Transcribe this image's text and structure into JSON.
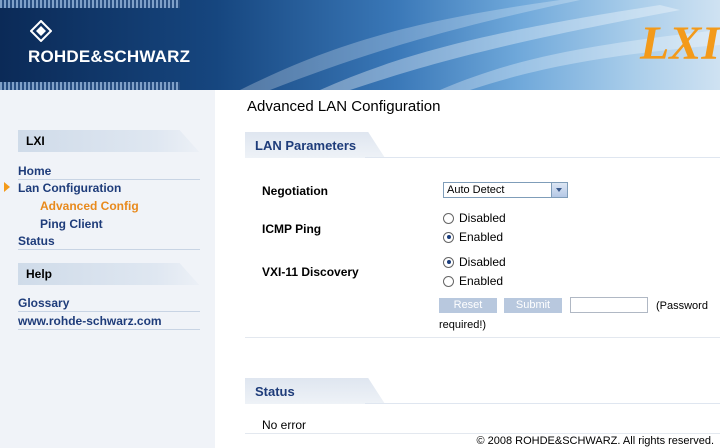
{
  "banner": {
    "brand": "ROHDE&SCHWARZ",
    "lxi_mark": "LXI"
  },
  "sidebar": {
    "sections": [
      {
        "title": "LXI"
      },
      {
        "title": "Help"
      }
    ],
    "lxi_items": [
      {
        "label": "Home"
      },
      {
        "label": "Lan Configuration"
      },
      {
        "label": "Advanced Config"
      },
      {
        "label": "Ping Client"
      },
      {
        "label": "Status"
      }
    ],
    "help_items": [
      {
        "label": "Glossary"
      },
      {
        "label": "www.rohde-schwarz.com"
      }
    ]
  },
  "main": {
    "title": "Advanced LAN Configuration",
    "lan_section": "LAN Parameters",
    "negotiation": {
      "label": "Negotiation",
      "value": "Auto Detect"
    },
    "icmp_ping": {
      "label": "ICMP Ping",
      "options": [
        "Disabled",
        "Enabled"
      ],
      "selected": "Enabled"
    },
    "vxi11": {
      "label": "VXI-11 Discovery",
      "options": [
        "Disabled",
        "Enabled"
      ],
      "selected": "Disabled"
    },
    "reset_label": "Reset",
    "submit_label": "Submit",
    "password_note_a": "(Password",
    "password_note_b": "required!)",
    "status_section": "Status",
    "status_text": "No error",
    "footer": "© 2008 ROHDE&SCHWARZ. All rights reserved."
  },
  "colors": {
    "accent": "#f39a1a",
    "link": "#1e3c7a",
    "active": "#e88a1d"
  }
}
